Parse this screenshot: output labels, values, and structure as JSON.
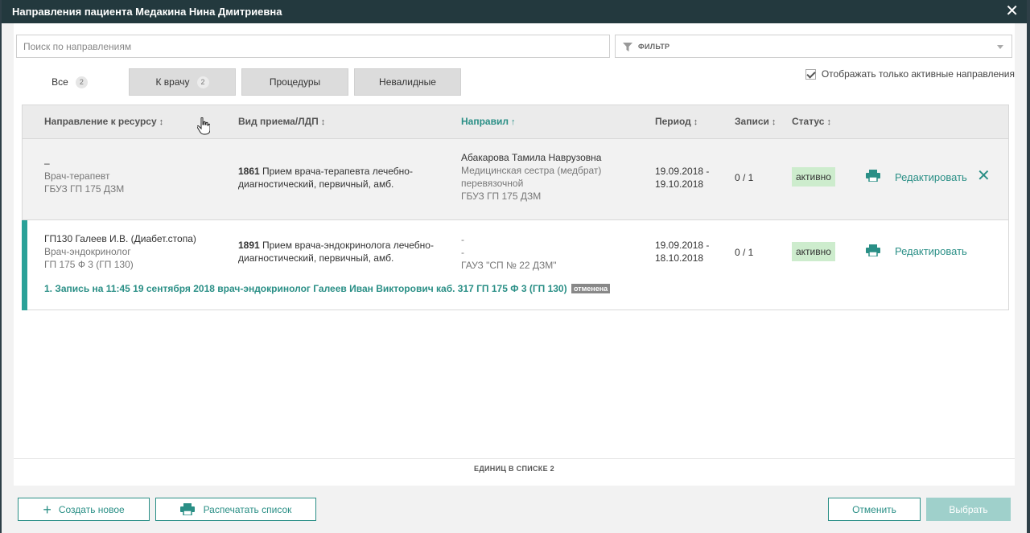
{
  "window": {
    "title": "Направления пациента Медакина Нина Дмитриевна"
  },
  "search": {
    "placeholder": "Поиск по направлениям"
  },
  "filter": {
    "label": "ФИЛЬТР"
  },
  "tabs": [
    {
      "label": "Все",
      "count": "2"
    },
    {
      "label": "К врачу",
      "count": "2"
    },
    {
      "label": "Процедуры"
    },
    {
      "label": "Невалидные"
    }
  ],
  "active_only": {
    "label": "Отображать только активные направления",
    "checked": true
  },
  "columns": {
    "resource": "Направление к ресурсу",
    "visit_type": "Вид приема/ЛДП",
    "referrer": "Направил",
    "period": "Период",
    "records": "Записи",
    "status": "Статус"
  },
  "rows": [
    {
      "resource_line1": "–",
      "resource_line2": "Врач-терапевт",
      "resource_line3": "ГБУЗ ГП 175 ДЗМ",
      "visit_code": "1861",
      "visit_desc_line1": " Прием врача-терапевта лечебно-",
      "visit_desc_line2": "диагностический, первичный, амб.",
      "referrer_line1": "Абакарова Тамила Наврузовна",
      "referrer_line2": "Медицинская сестра (медбрат)",
      "referrer_line3": "перевязочной",
      "referrer_line4": "ГБУЗ ГП 175 ДЗМ",
      "period_line1": "19.09.2018 -",
      "period_line2": "19.10.2018",
      "records": "0 / 1",
      "status": "активно",
      "edit": "Редактировать"
    },
    {
      "resource_line1": "ГП130 Галеев И.В. (Диабет.стопа)",
      "resource_line2": "Врач-эндокринолог",
      "resource_line3": "ГП 175 Ф 3 (ГП 130)",
      "visit_code": "1891",
      "visit_desc_line1": " Прием врача-эндокринолога лечебно-",
      "visit_desc_line2": "диагностический, первичный, амб.",
      "referrer_line1": "-",
      "referrer_line2": "-",
      "referrer_line3": "ГАУЗ \"СП № 22 ДЗМ\"",
      "period_line1": "19.09.2018 -",
      "period_line2": "18.10.2018",
      "records": "0 / 1",
      "status": "активно",
      "edit": "Редактировать",
      "appointment": "1. Запись на 11:45 19 сентября 2018 врач-эндокринолог Галеев Иван Викторович каб. 317 ГП 175 Ф 3 (ГП 130)",
      "appointment_status": "отменена"
    }
  ],
  "footer": {
    "units": "ЕДИНИЦ В СПИСКЕ 2"
  },
  "buttons": {
    "create": "Создать новое",
    "print_list": "Распечатать список",
    "cancel": "Отменить",
    "select": "Выбрать"
  },
  "colors": {
    "accent": "#2a8f86",
    "title_bar": "#23393e",
    "status_bg": "#cdeccd"
  }
}
